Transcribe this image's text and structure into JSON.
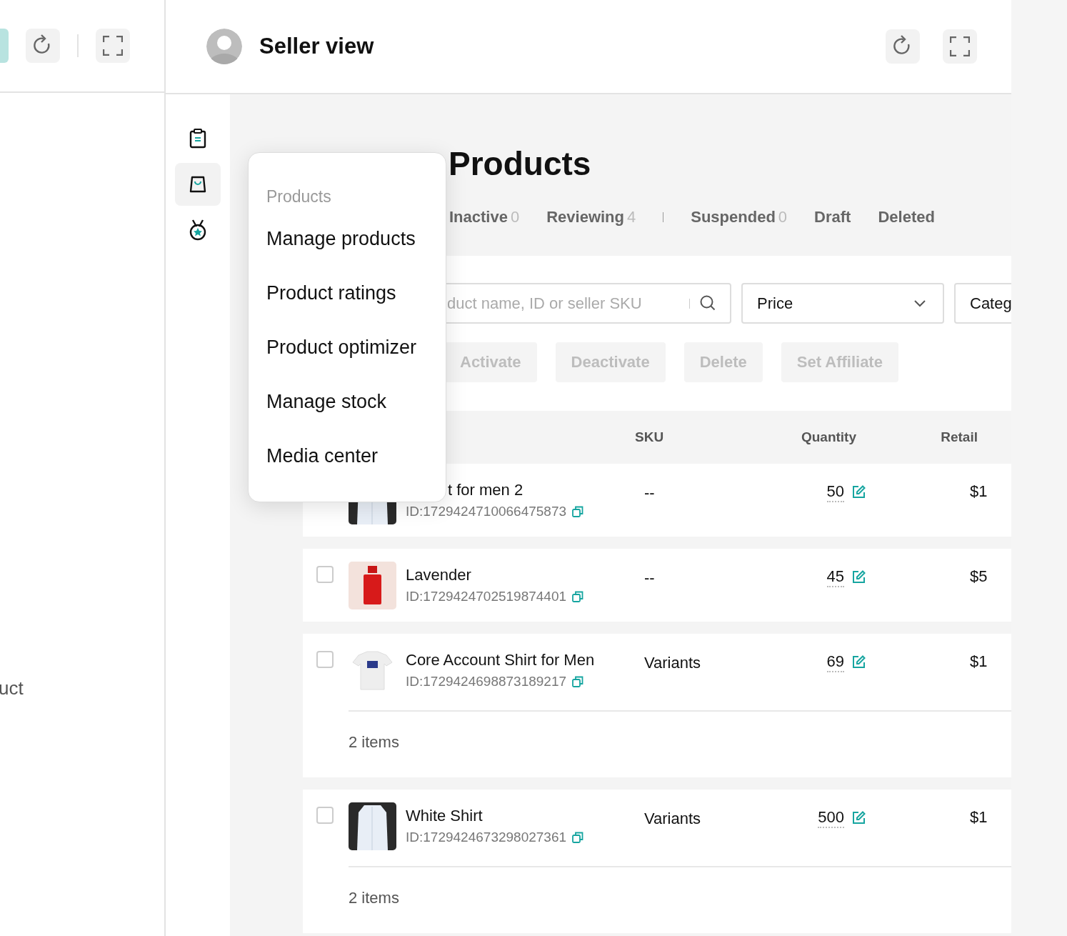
{
  "left_pane": {
    "partial_text": "uct"
  },
  "header": {
    "title": "Seller view"
  },
  "sidebar": {
    "items": [
      {
        "kind": "clipboard",
        "selected": false
      },
      {
        "kind": "bag",
        "selected": true
      },
      {
        "kind": "medal",
        "selected": false
      }
    ]
  },
  "page": {
    "title": "Products",
    "tabs": [
      {
        "label": "Inactive",
        "count": "0",
        "selected": false
      },
      {
        "label": "Reviewing",
        "count": "4",
        "selected": false
      },
      {
        "label": "Suspended",
        "count": "0",
        "selected": false
      },
      {
        "label": "Draft",
        "selected": false
      },
      {
        "label": "Deleted",
        "selected": false
      }
    ],
    "search": {
      "placeholder": "duct name, ID or seller SKU"
    },
    "filters": [
      {
        "value": "Price",
        "kind": "dropdown"
      },
      {
        "value": "Categ",
        "kind": "cut"
      }
    ],
    "actions": [
      {
        "label": "Activate",
        "disabled": true
      },
      {
        "label": "Deactivate",
        "disabled": true
      },
      {
        "label": "Delete",
        "disabled": true
      },
      {
        "label": "Set Affiliate",
        "disabled": true
      }
    ],
    "table": {
      "columns": [
        "SKU",
        "Quantity",
        "Retail"
      ],
      "rows": [
        {
          "name": "t for men 2",
          "id": "ID:1729424710066475873",
          "sku": "--",
          "quantity": "50",
          "retail": "$1",
          "kind": "dark-shirt",
          "overlapped": true
        },
        {
          "name": "Lavender",
          "id": "ID:1729424702519874401",
          "sku": "--",
          "quantity": "45",
          "retail": "$5",
          "kind": "red-bottle",
          "checked": false
        },
        {
          "name": "Core Account Shirt for Men",
          "id": "ID:1729424698873189217",
          "sku": "Variants",
          "quantity": "69",
          "retail": "$1",
          "kind": "white-tee",
          "checked": false,
          "footer": "2 items"
        },
        {
          "name": "White Shirt",
          "id": "ID:1729424673298027361",
          "sku": "Variants",
          "quantity": "500",
          "retail": "$1",
          "kind": "dark-shirt",
          "checked": false,
          "footer": "2 items"
        }
      ]
    }
  },
  "menu": {
    "heading": "Products",
    "items": [
      "Manage products",
      "Product ratings",
      "Product optimizer",
      "Manage stock",
      "Media center"
    ]
  }
}
